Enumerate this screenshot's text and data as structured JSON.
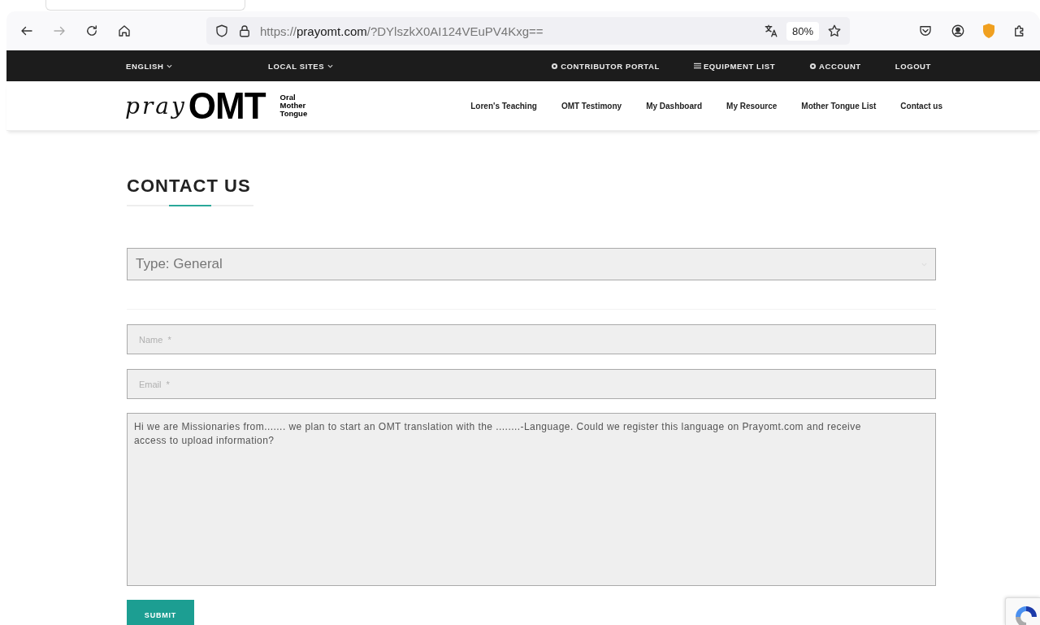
{
  "browser": {
    "url_scheme": "https://",
    "url_host": "prayomt.com",
    "url_path": "/?DYlszkX0AI124VEuPV4Kxg==",
    "zoom": "80%"
  },
  "top_bar": {
    "left": [
      {
        "label": "ENGLISH"
      },
      {
        "label": "LOCAL SITES"
      }
    ],
    "right": [
      {
        "label": "CONTRIBUTOR PORTAL",
        "kind": "gear"
      },
      {
        "label": "EQUIPMENT LIST",
        "kind": "list"
      },
      {
        "label": "ACCOUNT",
        "kind": "gear"
      },
      {
        "label": "LOGOUT",
        "kind": "plain"
      }
    ]
  },
  "logo": {
    "script": "pray",
    "mark": "OMT",
    "tagline": [
      "Oral",
      "Mother",
      "Tongue"
    ]
  },
  "nav": [
    "Loren's Teaching",
    "OMT Testimony",
    "My Dashboard",
    "My Resource",
    "Mother Tongue List",
    "Contact us"
  ],
  "page": {
    "title": "CONTACT US"
  },
  "form": {
    "type_select": "Type: General",
    "name": {
      "placeholder": "Name  *"
    },
    "email": {
      "placeholder": "Email  *"
    },
    "message": "Hi we are Missionaries from....... we plan to start an OMT translation with the ........-Language. Could we register this language on Prayomt.com and receive access to upload information?",
    "submit": "SUBMIT"
  }
}
